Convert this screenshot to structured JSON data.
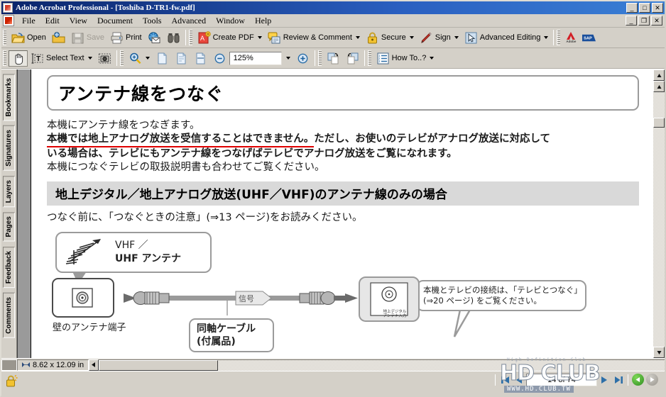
{
  "window": {
    "title": "Adobe Acrobat Professional - [Toshiba D-TR1-fw.pdf]",
    "app_icon": "acrobat-icon",
    "minimize": "_",
    "maximize": "□",
    "close": "✕",
    "restore": "❐"
  },
  "menu": {
    "items": [
      {
        "label": "File"
      },
      {
        "label": "Edit"
      },
      {
        "label": "View"
      },
      {
        "label": "Document"
      },
      {
        "label": "Tools"
      },
      {
        "label": "Advanced"
      },
      {
        "label": "Window"
      },
      {
        "label": "Help"
      }
    ]
  },
  "toolbar_main": {
    "open_label": "Open",
    "organizer_icon": "open-folder-icon",
    "save_label": "Save",
    "print_label": "Print",
    "email_icon": "email-icon",
    "search_icon": "binoculars-search-icon",
    "create_pdf_label": "Create PDF",
    "review_comment_label": "Review & Comment",
    "secure_label": "Secure",
    "sign_label": "Sign",
    "advanced_editing_label": "Advanced Editing",
    "adobe_logo": "Adobe",
    "sap_logo": "SAP"
  },
  "toolbar_second": {
    "hand_tool": "hand-tool-icon",
    "select_text_label": "Select Text",
    "snapshot_icon": "snapshot-camera-icon",
    "zoom_in_tool": "zoom-magnifier-icon",
    "page_view_actual": "actual-size-icon",
    "page_view_fit_page": "fit-page-icon",
    "page_view_fit_width": "fit-width-icon",
    "zoom_out_label": "−",
    "zoom_value": "125%",
    "zoom_in_label": "+",
    "rotate_cw_icon": "rotate-clockwise-icon",
    "rotate_ccw_icon": "rotate-counterclockwise-icon",
    "how_to_label": "How To..?"
  },
  "nav_pane": {
    "tabs": [
      {
        "label": "Bookmarks",
        "active": true
      },
      {
        "label": "Signatures",
        "active": false
      },
      {
        "label": "Layers",
        "active": false
      },
      {
        "label": "Pages",
        "active": false
      },
      {
        "label": "Feedback",
        "active": false
      },
      {
        "label": "Comments",
        "active": false
      }
    ]
  },
  "document": {
    "heading": "アンテナ線をつなぐ",
    "body_line_1": "本機にアンテナ線をつなぎます。",
    "body_line_2_underlined": "本機では地上アナログ放送を受信することはできません。",
    "body_line_2_rest": "ただし、お使いのテレビがアナログ放送に対応して",
    "body_line_3": "いる場合は、テレビにもアンテナ線をつなげばテレビでアナログ放送をご覧になれます。",
    "body_line_4": "本機につなぐテレビの取扱説明書も合わせてご覧ください。",
    "section_heading": "地上デジタル／地上アナログ放送(UHF／VHF)のアンテナ線のみの場合",
    "note_line": "つなぐ前に、「つなぐときの注意」(⇒13 ページ)をお読みください。",
    "callout_antenna_line1": "VHF ／",
    "callout_antenna_line2": "UHF アンテナ",
    "callout_tv_line1": "本機とテレビの接続は、「テレビとつなぐ」",
    "callout_tv_line2": "(⇒20 ページ) をご覧ください。",
    "label_wall_terminal": "壁のアンテナ端子",
    "label_coax_cable_1": "同軸ケーブル",
    "label_coax_cable_2": "(付属品)",
    "label_signal": "信号",
    "label_device_input_1": "地上デジタル",
    "label_device_input_2": "アンテナ入力"
  },
  "status": {
    "page_size": "8.62 x 12.09 in",
    "page_indicator": "14 of 74",
    "first_page_icon": "first-page-icon",
    "prev_page_icon": "previous-page-icon",
    "next_page_icon": "next-page-icon",
    "last_page_icon": "last-page-icon",
    "back_icon": "go-back-icon",
    "forward_icon": "go-forward-icon",
    "security_icon": "document-security-lock-icon"
  },
  "watermark": {
    "big": "HD CLUB",
    "url": "WWW.HD.CLUB.TW",
    "tagline": "High Definition Club"
  },
  "colors": {
    "title_bar": "#0a246a",
    "chrome": "#d4d0c8",
    "accent_red": "#e00000",
    "doc_gray_bar": "#d9d9d9"
  }
}
